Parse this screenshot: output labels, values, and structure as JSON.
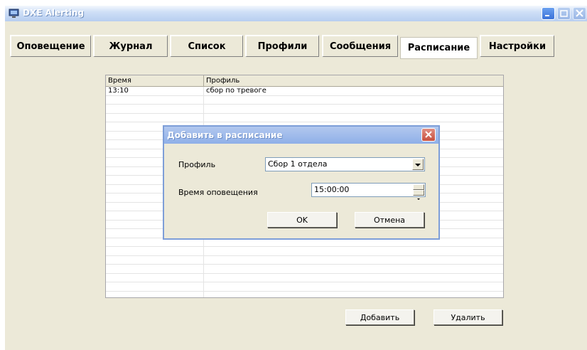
{
  "window": {
    "title": "DXE Alerting"
  },
  "tabs": [
    {
      "label": "Оповещение"
    },
    {
      "label": "Журнал"
    },
    {
      "label": "Список"
    },
    {
      "label": "Профили"
    },
    {
      "label": "Сообщения"
    },
    {
      "label": "Расписание",
      "active": true
    },
    {
      "label": "Настройки"
    }
  ],
  "schedule": {
    "columns": [
      "Время",
      "Профиль"
    ],
    "rows": [
      {
        "time": "13:10",
        "profile": "сбор по тревоге"
      }
    ]
  },
  "buttons": {
    "add": "Добавить",
    "delete": "Удалить"
  },
  "dialog": {
    "title": "Добавить в расписание",
    "profile_label": "Профиль",
    "profile_value": "Сбор 1 отдела",
    "time_label": "Время оповещения",
    "time_value": "15:00:00",
    "ok": "OK",
    "cancel": "Отмена"
  },
  "icons": {
    "app": "app-icon",
    "minimize": "minimize-icon",
    "maximize": "maximize-icon",
    "close": "close-icon",
    "dropdown": "chevron-down-icon",
    "spin": "spinner-arrows-icon"
  }
}
